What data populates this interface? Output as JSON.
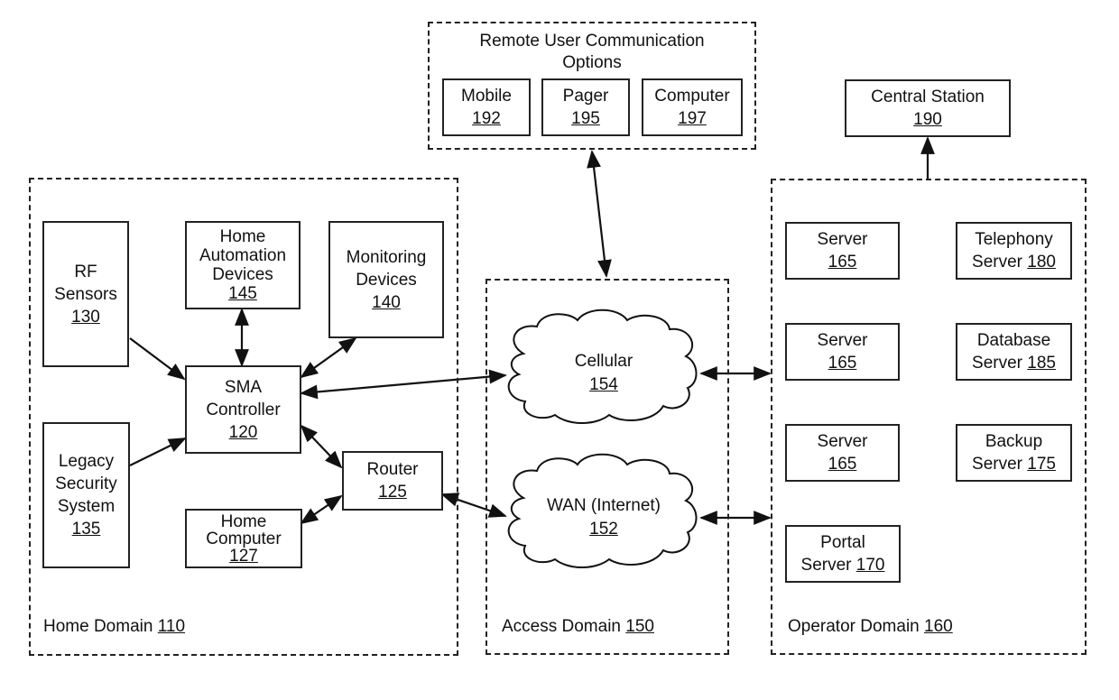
{
  "remote_options": {
    "title_line1": "Remote User Communication",
    "title_line2": "Options",
    "items": [
      {
        "label": "Mobile",
        "ref": "192"
      },
      {
        "label": "Pager",
        "ref": "195"
      },
      {
        "label": "Computer",
        "ref": "197"
      }
    ]
  },
  "central_station": {
    "label": "Central Station",
    "ref": "190"
  },
  "home_domain": {
    "label": "Home Domain",
    "ref": "110",
    "rf_sensors": {
      "line1": "RF",
      "line2": "Sensors",
      "ref": "130"
    },
    "home_automation": {
      "line1": "Home",
      "line2": "Automation",
      "line3": "Devices",
      "ref": "145"
    },
    "monitoring": {
      "line1": "Monitoring",
      "line2": "Devices",
      "ref": "140"
    },
    "sma_controller": {
      "line1": "SMA",
      "line2": "Controller",
      "ref": "120"
    },
    "legacy_security": {
      "line1": "Legacy",
      "line2": "Security",
      "line3": "System",
      "ref": "135"
    },
    "router": {
      "label": "Router",
      "ref": "125"
    },
    "home_computer": {
      "line1": "Home",
      "line2": "Computer",
      "ref": "127"
    }
  },
  "access_domain": {
    "label": "Access Domain",
    "ref": "150",
    "cellular": {
      "label": "Cellular",
      "ref": "154"
    },
    "wan": {
      "label": "WAN (Internet)",
      "ref": "152"
    }
  },
  "operator_domain": {
    "label": "Operator Domain",
    "ref": "160",
    "servers": [
      {
        "line1": "Server",
        "ref": "165"
      },
      {
        "line1": "Server",
        "ref": "165"
      },
      {
        "line1": "Server",
        "ref": "165"
      }
    ],
    "telephony": {
      "line1": "Telephony",
      "line2": "Server",
      "ref": "180"
    },
    "database": {
      "line1": "Database",
      "line2": "Server",
      "ref": "185"
    },
    "backup": {
      "line1": "Backup",
      "line2": "Server",
      "ref": "175"
    },
    "portal": {
      "line1": "Portal",
      "line2": "Server",
      "ref": "170"
    }
  }
}
